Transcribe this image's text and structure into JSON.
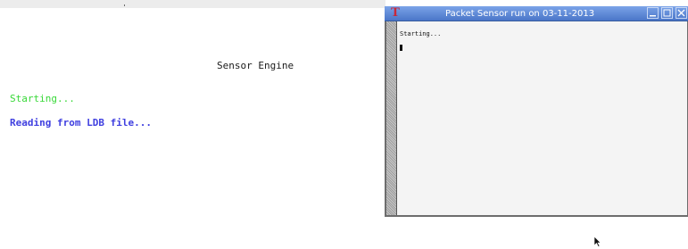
{
  "console": {
    "heading": "Sensor Engine",
    "lines": [
      "Starting...",
      "Reading from LDB file..."
    ],
    "colors": {
      "starting": "#38d838",
      "reading": "#4040e0"
    }
  },
  "terminal_window": {
    "title": "Packet Sensor run on 03-11-2013",
    "app_icon": "terminal-t-icon",
    "buttons": [
      "minimize-icon",
      "maximize-icon",
      "close-icon"
    ],
    "output": "Starting...",
    "titlebar_color": "#5b86d6"
  },
  "pointer": "mouse-pointer-icon"
}
